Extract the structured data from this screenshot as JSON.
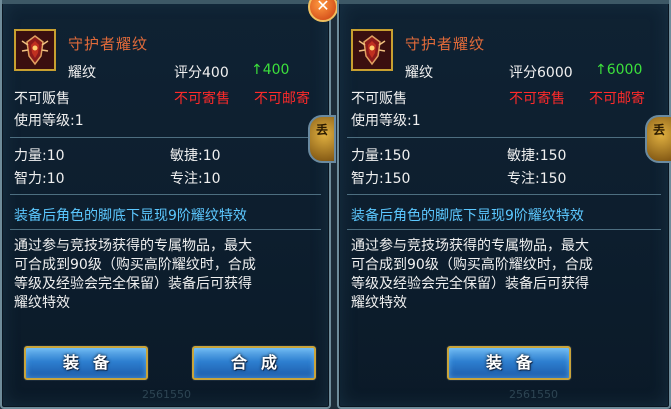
{
  "left": {
    "name": "守护者耀纹",
    "type": "耀纹",
    "score_label": "评分400",
    "score_up": "↑400",
    "not_sell": "不可贩售",
    "not_consign": "不可寄售",
    "not_mail": "不可邮寄",
    "level": "使用等级:1",
    "str": "力量:10",
    "agi": "敏捷:10",
    "int": "智力:10",
    "foc": "专注:10",
    "effect": "装备后角色的脚底下显现9阶耀纹特效",
    "desc1": "通过参与竞技场获得的专属物品，最大",
    "desc2": "可合成到90级（购买高阶耀纹时，合成",
    "desc3": "等级及经验会完全保留）装备后可获得",
    "desc4": "耀纹特效",
    "equip_btn": "装备",
    "merge_btn": "合成",
    "side_tab": "丢",
    "faint_num": "2561550"
  },
  "right": {
    "name": "守护者耀纹",
    "type": "耀纹",
    "score_label": "评分6000",
    "score_up": "↑6000",
    "not_sell": "不可贩售",
    "not_consign": "不可寄售",
    "not_mail": "不可邮寄",
    "level": "使用等级:1",
    "str": "力量:150",
    "agi": "敏捷:150",
    "int": "智力:150",
    "foc": "专注:150",
    "effect": "装备后角色的脚底下显现9阶耀纹特效",
    "desc1": "通过参与竞技场获得的专属物品，最大",
    "desc2": "可合成到90级（购买高阶耀纹时，合成",
    "desc3": "等级及经验会完全保留）装备后可获得",
    "desc4": "耀纹特效",
    "equip_btn": "装备",
    "side_tab": "丢",
    "faint_num": "2561550"
  },
  "colors": {
    "name": "#e06a3a",
    "score_up": "#3ce03c",
    "restriction": "#ff2a2a",
    "effect": "#5cc8ff",
    "frame": "#c8a030"
  },
  "icons": {
    "item": "emblem-icon",
    "close": "close-icon"
  }
}
